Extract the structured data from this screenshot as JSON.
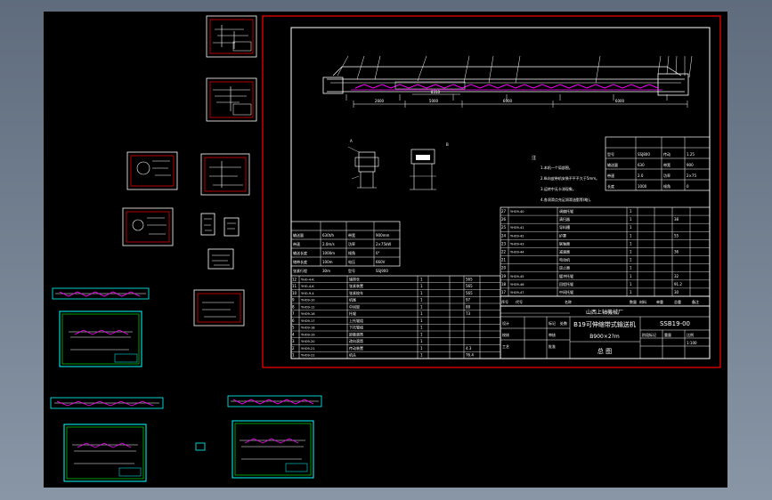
{
  "drawing": {
    "factory_name": "山西上轴機械厂",
    "product_title": "B19可伸缩带式输送机",
    "drawing_number": "SSB19-00",
    "spec": "B900×2?m",
    "sheet_name": "总 图",
    "notes_heading": "注",
    "notes": [
      "1.本机一个局部图。",
      "2.纵向皮带机安装不平不大于5mm。",
      "3.运转中无卡滞现象。",
      "4.各润滑点充足润滑油脂等(略)。"
    ],
    "dim_segments": [
      "2600",
      "5000",
      "6000",
      "6000"
    ],
    "dim_small": "8310",
    "parts_header": [
      "序号",
      "代号",
      "名称",
      "数量",
      "材料",
      "单重",
      "总重",
      "备注"
    ],
    "parts_left": [
      {
        "no": "12",
        "code": "YHO-4-K",
        "name": "储带仓",
        "qty": "1",
        "mat": "",
        "w": "565"
      },
      {
        "no": "11",
        "code": "YHO-4-K",
        "name": "张紧装置",
        "qty": "1",
        "mat": "",
        "w": "565"
      },
      {
        "no": "10",
        "code": "YHO-9-4",
        "name": "张紧绞车",
        "qty": "1",
        "mat": "",
        "w": "565"
      },
      {
        "no": "9",
        "code": "YHO9-10",
        "name": "机尾",
        "qty": "1",
        "mat": "",
        "w": "97"
      },
      {
        "no": "8",
        "code": "YHO9-12",
        "name": "中间架",
        "qty": "1",
        "mat": "",
        "w": "88"
      },
      {
        "no": "7",
        "code": "YHO9-16",
        "name": "托辊",
        "qty": "1",
        "mat": "",
        "w": "73"
      },
      {
        "no": "6",
        "code": "YHO9-17",
        "name": "上托辊组",
        "qty": "1",
        "mat": "",
        "w": ""
      },
      {
        "no": "5",
        "code": "YHO9-18",
        "name": "下托辊组",
        "qty": "1",
        "mat": "",
        "w": ""
      },
      {
        "no": "4",
        "code": "YHO9-19",
        "name": "卸载滚筒",
        "qty": "1",
        "mat": "",
        "w": ""
      },
      {
        "no": "3",
        "code": "YHO9-20",
        "name": "改向滚筒",
        "qty": "1",
        "mat": "",
        "w": ""
      },
      {
        "no": "2",
        "code": "YHO9-21",
        "name": "传动装置",
        "qty": "1",
        "mat": "",
        "w": "4.3"
      },
      {
        "no": "1",
        "code": "YHO9-22",
        "name": "机头",
        "qty": "1",
        "mat": "",
        "w": "76.4"
      }
    ],
    "parts_right": [
      {
        "no": "27",
        "code": "YHO9-40",
        "name": "调偏托辊",
        "qty": "1",
        "w": ""
      },
      {
        "no": "26",
        "code": "",
        "name": "清扫器",
        "qty": "1",
        "w": "38"
      },
      {
        "no": "25",
        "code": "YHO9-41",
        "name": "导料槽",
        "qty": "1",
        "w": ""
      },
      {
        "no": "24",
        "code": "YHO9-42",
        "name": "护罩",
        "qty": "1",
        "w": "55"
      },
      {
        "no": "23",
        "code": "YHO9-43",
        "name": "联轴器",
        "qty": "1",
        "w": ""
      },
      {
        "no": "22",
        "code": "YHO9-44",
        "name": "减速器",
        "qty": "1",
        "w": "36"
      },
      {
        "no": "21",
        "code": "",
        "name": "电动机",
        "qty": "1",
        "w": ""
      },
      {
        "no": "20",
        "code": "",
        "name": "逆止器",
        "qty": "1",
        "w": ""
      },
      {
        "no": "19",
        "code": "YHO9-45",
        "name": "缓冲托辊",
        "qty": "1",
        "w": "32"
      },
      {
        "no": "18",
        "code": "YHO9-46",
        "name": "回程托辊",
        "qty": "1",
        "w": "91.2"
      },
      {
        "no": "17",
        "code": "YHO9-47",
        "name": "中间托辊",
        "qty": "1",
        "w": "30"
      }
    ],
    "tech_table": [
      [
        "输送量",
        "630t/h",
        "带宽",
        "900mm"
      ],
      [
        "带速",
        "2.0m/s",
        "功率",
        "2×75kW"
      ],
      [
        "输送长度",
        "1000m",
        "倾角",
        "0°"
      ],
      [
        "储带长度",
        "100m",
        "电压",
        "660V"
      ],
      [
        "张紧行程",
        "30m",
        "型号",
        "SSJ900"
      ]
    ],
    "mini_table": [
      [
        "型号",
        "SSJ800",
        "传动",
        "1.25"
      ],
      [
        "输送量",
        "630",
        "带宽",
        "900"
      ],
      [
        "带速",
        "2.0",
        "功率",
        "2×75"
      ],
      [
        "长度",
        "1000",
        "倾角",
        "0"
      ]
    ],
    "title_rows": [
      [
        "设计",
        "",
        "标记",
        "处数"
      ],
      [
        "校核",
        "",
        "审核",
        ""
      ],
      [
        "工艺",
        "",
        "批准",
        ""
      ]
    ],
    "title_right": [
      "阶段标记",
      "重量",
      "比例",
      "1:100"
    ],
    "label_A": "A",
    "label_B": "B"
  },
  "colors": {
    "border_red": "#ff0000",
    "line_white": "#ffffff",
    "magenta": "#ff00ff",
    "cyan": "#00ffff",
    "yellow": "#ffff00",
    "green": "#00ff00"
  }
}
